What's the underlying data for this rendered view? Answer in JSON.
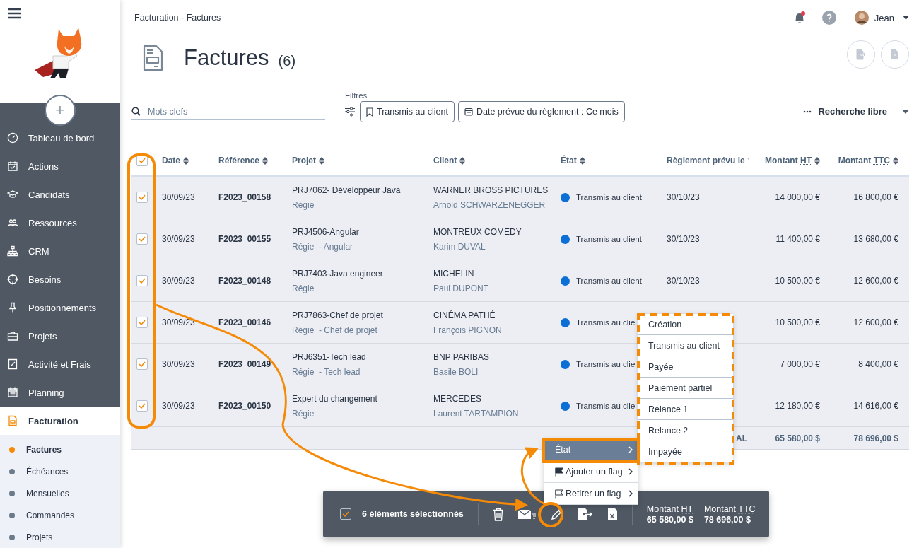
{
  "sidebar": {
    "add_button": "+",
    "items": [
      {
        "label": "Tableau de bord",
        "selected": false
      },
      {
        "label": "Actions",
        "selected": false
      },
      {
        "label": "Candidats",
        "selected": false
      },
      {
        "label": "Ressources",
        "selected": false
      },
      {
        "label": "CRM",
        "selected": false
      },
      {
        "label": "Besoins",
        "selected": false
      },
      {
        "label": "Positionnements",
        "selected": false
      },
      {
        "label": "Projets",
        "selected": false
      },
      {
        "label": "Activité et Frais",
        "selected": false
      },
      {
        "label": "Planning",
        "selected": false
      },
      {
        "label": "Facturation",
        "selected": true
      }
    ],
    "subitems": [
      {
        "label": "Factures",
        "selected": true
      },
      {
        "label": "Échéances",
        "selected": false
      },
      {
        "label": "Mensuelles",
        "selected": false
      },
      {
        "label": "Commandes",
        "selected": false
      },
      {
        "label": "Projets",
        "selected": false
      }
    ]
  },
  "header": {
    "breadcrumb": "Facturation - Factures",
    "notifications_unread": true,
    "user": "Jean"
  },
  "title": {
    "text": "Factures",
    "count": "(6)"
  },
  "search": {
    "placeholder": "Mots clefs"
  },
  "filters": {
    "label": "Filtres",
    "chips": [
      {
        "label": "Transmis au client",
        "kind": "bookmark"
      },
      {
        "label": "Date prévue du règlement : Ce mois",
        "kind": "calendar"
      }
    ]
  },
  "free_search": "Recherche libre",
  "table": {
    "all_checked": true,
    "columns": [
      {
        "label": "Date",
        "sorted": false
      },
      {
        "label": "Référence",
        "sorted": false
      },
      {
        "label": "Projet",
        "sorted": false
      },
      {
        "label": "Client",
        "sorted": false
      },
      {
        "label": "État",
        "sorted": false
      },
      {
        "label": "Règlement prévu le",
        "sorted": true
      },
      {
        "label": "Montant",
        "abbr": "HT",
        "sorted": false
      },
      {
        "label": "Montant",
        "abbr": "TTC",
        "sorted": false
      }
    ],
    "rows": [
      {
        "checked": true,
        "date": "30/09/23",
        "reference": "F2023_00158",
        "project": "PRJ7062- Développeur Java",
        "project_detail": "Régie",
        "client": "WARNER BROSS PICTURES",
        "contact": "Arnold SCHWARZENEGGER",
        "state": "Transmis au client",
        "color": "#0c6fd6",
        "payment_date": "30/10/23",
        "amount_ht": "14 000,00 €",
        "amount_ttc": "16 800,00 €"
      },
      {
        "checked": true,
        "date": "30/09/23",
        "reference": "F2023_00155",
        "project": "PRJ4506-Angular",
        "project_detail": "Régie  - Angular",
        "client": "MONTREUX COMEDY",
        "contact": "Karim DUVAL",
        "state": "Transmis au client",
        "color": "#0c6fd6",
        "payment_date": "30/10/23",
        "amount_ht": "11 400,00 €",
        "amount_ttc": "13 680,00 €"
      },
      {
        "checked": true,
        "date": "30/09/23",
        "reference": "F2023_00148",
        "project": "PRJ7403-Java engineer",
        "project_detail": "Régie",
        "client": "MICHELIN",
        "contact": "Paul DUPONT",
        "state": "Transmis au client",
        "color": "#0c6fd6",
        "payment_date": "30/10/23",
        "amount_ht": "10 500,00 €",
        "amount_ttc": "12 600,00 €"
      },
      {
        "checked": true,
        "date": "30/09/23",
        "reference": "F2023_00146",
        "project": "PRJ7863-Chef de projet",
        "project_detail": "Régie  - Chef de projet",
        "client": "CINÉMA PATHÉ",
        "contact": "François PIGNON",
        "state": "Transmis au clie",
        "color": "#0c6fd6",
        "amount_ht": "10 500,00 €",
        "amount_ttc": "12 600,00 €"
      },
      {
        "checked": true,
        "date": "30/09/23",
        "reference": "F2023_00149",
        "project": "PRJ6351-Tech lead",
        "project_detail": "Régie  - Tech lead",
        "client": "BNP PARIBAS",
        "contact": "Basile BOLI",
        "state": "Transmis au clie",
        "color": "#0c6fd6",
        "amount_ht": "7 000,00 €",
        "amount_ttc": "8 400,00 €"
      },
      {
        "checked": true,
        "date": "30/09/23",
        "reference": "F2023_00150",
        "project": "Expert du changement",
        "project_detail": "Régie",
        "client": "MERCEDES",
        "contact": "Laurent TARTAMPION",
        "state": "Transmis au clie",
        "color": "#0c6fd6",
        "amount_ht": "12 180,00 €",
        "amount_ttc": "14 616,00 €"
      }
    ],
    "total": {
      "label": "AL",
      "amount_ht": "65 580,00 $",
      "amount_ttc": "78 696,00 $"
    }
  },
  "context_menu": {
    "items": [
      {
        "label": "État",
        "kind": "plain",
        "selected": true
      },
      {
        "label": "Ajouter un flag",
        "kind": "flag",
        "selected": false
      },
      {
        "label": "Retirer un flag",
        "kind": "flag-outline",
        "selected": false
      }
    ],
    "submenu": [
      "Création",
      "Transmis au client",
      "Payée",
      "Paiement partiel",
      "Relance 1",
      "Relance 2",
      "Impayée"
    ]
  },
  "selection_bar": {
    "checked": true,
    "text": "6 éléments sélectionnés",
    "totals": [
      {
        "label": "Montant",
        "abbr": "HT",
        "value": "65 580,00 $"
      },
      {
        "label": "Montant",
        "abbr": "TTC",
        "value": "78 696,00 $"
      }
    ]
  }
}
